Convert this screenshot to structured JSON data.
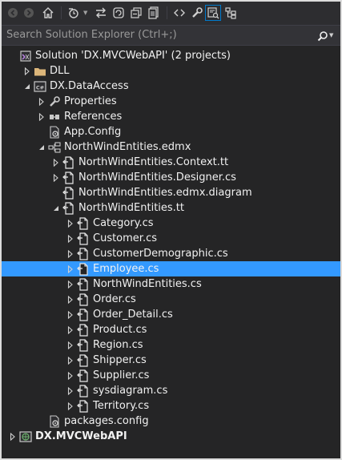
{
  "toolbar": {
    "buttons": [
      {
        "name": "back-icon",
        "glyph": "◀",
        "disabled": true
      },
      {
        "name": "forward-icon",
        "glyph": "▶",
        "disabled": true
      },
      {
        "name": "home-icon",
        "glyph": "⌂"
      },
      {
        "name": "pending-changes-filter-icon",
        "glyph": "◷"
      },
      {
        "name": "sync-with-active-document-icon",
        "glyph": "⇄"
      },
      {
        "name": "refresh-icon",
        "glyph": "↻"
      },
      {
        "name": "collapse-all-icon",
        "glyph": "⊟"
      },
      {
        "name": "show-all-files-icon",
        "glyph": "▤"
      },
      {
        "name": "view-code-icon",
        "glyph": "‹›"
      },
      {
        "name": "properties-icon",
        "glyph": "🔧"
      },
      {
        "name": "preview-selected-items-icon",
        "glyph": "⧉"
      },
      {
        "name": "class-view-icon",
        "glyph": "⊞"
      }
    ]
  },
  "search": {
    "placeholder": "Search Solution Explorer (Ctrl+;)"
  },
  "tree": [
    {
      "label": "Solution 'DX.MVCWebAPI' (2 projects)",
      "indent": 0,
      "expander": "none",
      "icon": "solution"
    },
    {
      "label": "DLL",
      "indent": 1,
      "expander": "collapsed",
      "icon": "folder"
    },
    {
      "label": "DX.DataAccess",
      "indent": 1,
      "expander": "expanded",
      "icon": "csproj"
    },
    {
      "label": "Properties",
      "indent": 2,
      "expander": "collapsed",
      "icon": "wrench"
    },
    {
      "label": "References",
      "indent": 2,
      "expander": "collapsed",
      "icon": "references"
    },
    {
      "label": "App.Config",
      "indent": 2,
      "expander": "none",
      "icon": "config"
    },
    {
      "label": "NorthWindEntities.edmx",
      "indent": 2,
      "expander": "expanded",
      "icon": "edmx"
    },
    {
      "label": "NorthWindEntities.Context.tt",
      "indent": 3,
      "expander": "collapsed",
      "icon": "file"
    },
    {
      "label": "NorthWindEntities.Designer.cs",
      "indent": 3,
      "expander": "collapsed",
      "icon": "file"
    },
    {
      "label": "NorthWindEntities.edmx.diagram",
      "indent": 3,
      "expander": "none",
      "icon": "file"
    },
    {
      "label": "NorthWindEntities.tt",
      "indent": 3,
      "expander": "expanded",
      "icon": "file"
    },
    {
      "label": "Category.cs",
      "indent": 4,
      "expander": "collapsed",
      "icon": "file"
    },
    {
      "label": "Customer.cs",
      "indent": 4,
      "expander": "collapsed",
      "icon": "file"
    },
    {
      "label": "CustomerDemographic.cs",
      "indent": 4,
      "expander": "collapsed",
      "icon": "file"
    },
    {
      "label": "Employee.cs",
      "indent": 4,
      "expander": "collapsed",
      "icon": "file",
      "selected": true
    },
    {
      "label": "NorthWindEntities.cs",
      "indent": 4,
      "expander": "collapsed",
      "icon": "file"
    },
    {
      "label": "Order.cs",
      "indent": 4,
      "expander": "collapsed",
      "icon": "file"
    },
    {
      "label": "Order_Detail.cs",
      "indent": 4,
      "expander": "collapsed",
      "icon": "file"
    },
    {
      "label": "Product.cs",
      "indent": 4,
      "expander": "collapsed",
      "icon": "file"
    },
    {
      "label": "Region.cs",
      "indent": 4,
      "expander": "collapsed",
      "icon": "file"
    },
    {
      "label": "Shipper.cs",
      "indent": 4,
      "expander": "collapsed",
      "icon": "file"
    },
    {
      "label": "Supplier.cs",
      "indent": 4,
      "expander": "collapsed",
      "icon": "file"
    },
    {
      "label": "sysdiagram.cs",
      "indent": 4,
      "expander": "collapsed",
      "icon": "file"
    },
    {
      "label": "Territory.cs",
      "indent": 4,
      "expander": "collapsed",
      "icon": "file"
    },
    {
      "label": "packages.config",
      "indent": 2,
      "expander": "none",
      "icon": "config"
    },
    {
      "label": "DX.MVCWebAPI",
      "indent": 0,
      "expander": "collapsed",
      "icon": "webproj",
      "bold": true
    }
  ],
  "colors": {
    "background": "#252526",
    "toolbar": "#2d2d30",
    "search_box": "#333337",
    "text": "#f1f1f1",
    "selection": "#3399ff",
    "accent": "#007acc"
  }
}
